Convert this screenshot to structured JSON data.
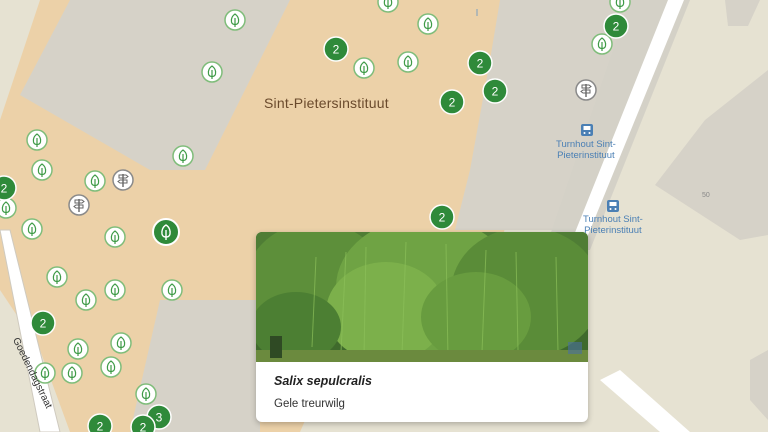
{
  "map": {
    "campus_label": "Sint-Pietersinstituut",
    "bus_stops": [
      {
        "label_line1": "Turnhout Sint-",
        "label_line2": "Pieterinstituut",
        "icon": "bus-stop-icon"
      },
      {
        "label_line1": "Turnhout Sint-",
        "label_line2": "Pieterinstituut",
        "icon": "bus-stop-icon"
      }
    ],
    "street_name": "Goedendagstraat",
    "house_number": "50",
    "tree_icon": "tree-icon",
    "signpost_icon": "signpost-icon",
    "cluster_counts": [
      "2",
      "2",
      "2",
      "2",
      "2",
      "2",
      "2",
      "2",
      "2",
      "3",
      "2",
      "2"
    ],
    "colors": {
      "cluster_fill": "#2f8a3a",
      "tree_marker_border": "#3d9a46",
      "selected_marker": "#2f8a3a",
      "bus_stop": "#4a7fb4"
    }
  },
  "card": {
    "scientific_name": "Salix sepulcralis",
    "common_name": "Gele treurwilg",
    "photo_icon": "weeping-willow-photo"
  }
}
